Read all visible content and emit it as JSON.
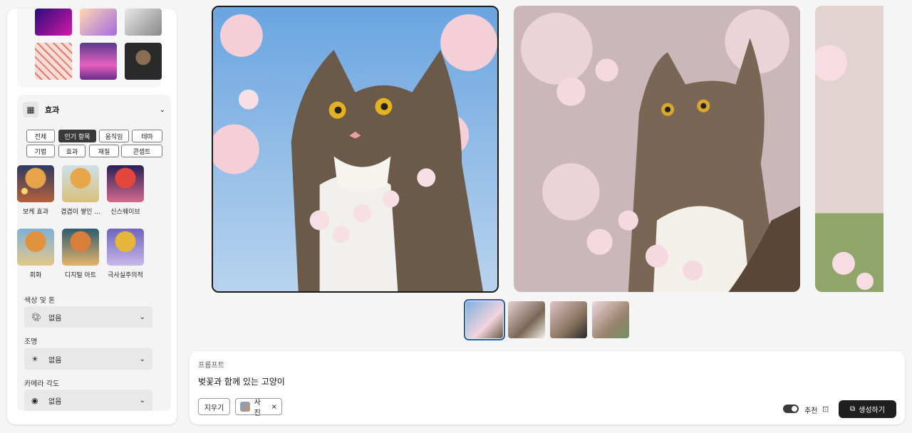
{
  "effects": {
    "title": "효과",
    "filters": [
      "전체",
      "인기 항목",
      "움직임",
      "테마",
      "기법",
      "효과",
      "재질",
      "콘셉트"
    ],
    "active_filter": "인기 항목",
    "styles": [
      {
        "label": "보케 효과"
      },
      {
        "label": "겹겹이 쌓인 ..."
      },
      {
        "label": "신스웨이브"
      },
      {
        "label": "회화"
      },
      {
        "label": "디지털 아트"
      },
      {
        "label": "극사실주의적"
      }
    ]
  },
  "color_tone": {
    "label": "색상 및 톤",
    "value": "없음",
    "icon": "palette-icon"
  },
  "lighting": {
    "label": "조명",
    "value": "없음",
    "icon": "bulb-icon"
  },
  "camera": {
    "label": "카메라 각도",
    "value": "없음",
    "icon": "camera-icon"
  },
  "prompt": {
    "label": "프롬프트",
    "text": "벚꽃과 함께 있는 고양이",
    "clear_label": "지우기",
    "tag_label": "사진",
    "recommend_label": "추천",
    "generate_label": "생성하기"
  },
  "colors": {
    "accent": "#2a5db0",
    "dark": "#1f1f1f"
  }
}
